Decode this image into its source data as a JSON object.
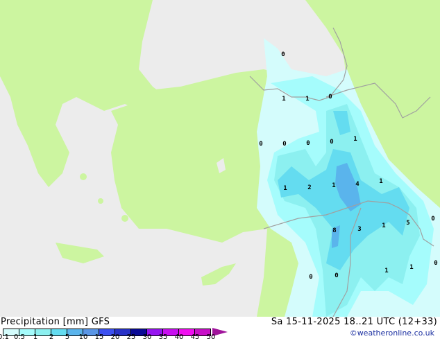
{
  "legend": {
    "title": "Precipitation [mm]  GFS",
    "datetime": "Sa 15-11-2025 18..21 UTC (12+33)",
    "credit": "©weatheronline.co.uk",
    "ticks": [
      "0.1",
      "0.5",
      "1",
      "2",
      "5",
      "10",
      "15",
      "20",
      "25",
      "30",
      "35",
      "40",
      "45",
      "50"
    ],
    "colors": [
      "#d4fcfc",
      "#a5fcfc",
      "#8cf0f0",
      "#64dcf0",
      "#5ab4ec",
      "#5a96e6",
      "#3c50f0",
      "#2832c8",
      "#0a0a96",
      "#9614f0",
      "#c80ff0",
      "#f00ff0",
      "#c80fc8"
    ],
    "arrow_color": "#a0149b"
  },
  "map": {
    "land_color": "#ccf5a0",
    "sea_color": "#ececec",
    "border_color": "#a0a0a0",
    "values": [
      "0",
      "1",
      "1",
      "0",
      "0",
      "0",
      "0",
      "0",
      "1",
      "1",
      "2",
      "1",
      "4",
      "1",
      "8",
      "3",
      "1",
      "5",
      "0",
      "1",
      "1",
      "0",
      "0",
      "0"
    ]
  }
}
